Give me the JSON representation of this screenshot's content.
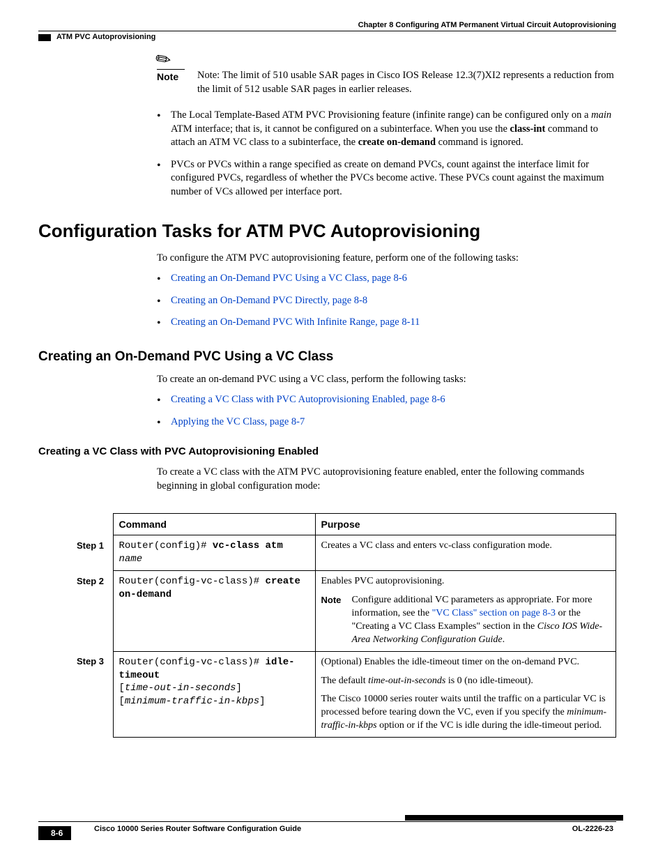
{
  "header": {
    "chapter": "Chapter 8      Configuring ATM Permanent Virtual Circuit Autoprovisioning",
    "section": "ATM PVC Autoprovisioning"
  },
  "note": {
    "label": "Note",
    "text": "Note: The limit of 510 usable SAR pages in Cisco IOS Release 12.3(7)XI2 represents a reduction from the limit of 512 usable SAR pages in earlier releases."
  },
  "top_bullets": {
    "b1a": "The Local Template-Based ATM PVC Provisioning feature (infinite range) can be configured only on a ",
    "b1b": "main",
    "b1c": " ATM interface; that is, it cannot be configured on a subinterface. When you use the ",
    "b1d": "class-int",
    "b1e": " command to attach an ATM VC class to a subinterface, the ",
    "b1f": "create on-demand",
    "b1g": " command is ignored.",
    "b2": "PVCs or PVCs within a range specified as create on demand PVCs, count against the interface limit for configured PVCs, regardless of whether the PVCs become active. These PVCs count against the maximum number of VCs allowed per interface port."
  },
  "h2": "Configuration Tasks for ATM PVC Autoprovisioning",
  "p_after_h2": "To configure the ATM PVC autoprovisioning feature, perform one of the following tasks:",
  "links1": {
    "l1": "Creating an On-Demand PVC Using a VC Class, page 8-6",
    "l2": "Creating an On-Demand PVC Directly, page 8-8",
    "l3": "Creating an On-Demand PVC With Infinite Range, page 8-11"
  },
  "h3": "Creating an On-Demand PVC Using a VC Class",
  "p_after_h3": "To create an on-demand PVC using a VC class, perform the following tasks:",
  "links2": {
    "l1": "Creating a VC Class with PVC Autoprovisioning Enabled, page 8-6",
    "l2": "Applying the VC Class, page 8-7"
  },
  "h4": "Creating a VC Class with PVC Autoprovisioning Enabled",
  "p_after_h4": "To create a VC class with the ATM PVC autoprovisioning feature enabled, enter the following commands beginning in global configuration mode:",
  "table": {
    "head_cmd": "Command",
    "head_purpose": "Purpose",
    "step1": "Step 1",
    "step2": "Step 2",
    "step3": "Step 3",
    "r1": {
      "prompt": "Router(config)# ",
      "bold": "vc-class atm ",
      "arg": "name",
      "purpose": "Creates a VC class and enters vc-class configuration mode."
    },
    "r2": {
      "prompt": "Router(config-vc-class)# ",
      "bold": "create on-demand",
      "p1": "Enables PVC autoprovisioning.",
      "note_label": "Note",
      "note_a": "Configure additional VC parameters as appropriate. For more information, see the ",
      "note_link": "\"VC Class\" section on page 8-3",
      "note_b": " or the \"Creating a VC Class Examples\" section in the ",
      "note_c": "Cisco IOS Wide-Area Networking Configuration Guide",
      "note_d": "."
    },
    "r3": {
      "prompt": "Router(config-vc-class)# ",
      "bold": "idle-timeout",
      "line2a": "[",
      "line2b": "time-out-in-seconds",
      "line2c": "]",
      "line3a": "[",
      "line3b": "minimum-traffic-in-kbps",
      "line3c": "]",
      "p1": "(Optional) Enables the idle-timeout timer on the on-demand PVC.",
      "p2a": "The default ",
      "p2b": "time-out-in-seconds",
      "p2c": " is 0 (no idle-timeout).",
      "p3a": "The Cisco 10000 series router waits until the traffic on a particular VC is processed before tearing down the VC, even if you specify the ",
      "p3b": "minimum-traffic-in-kbps",
      "p3c": " option or if the VC is idle during the idle-timeout period."
    }
  },
  "footer": {
    "title": "Cisco 10000 Series Router Software Configuration Guide",
    "doc": "OL-2226-23",
    "page": "8-6"
  }
}
